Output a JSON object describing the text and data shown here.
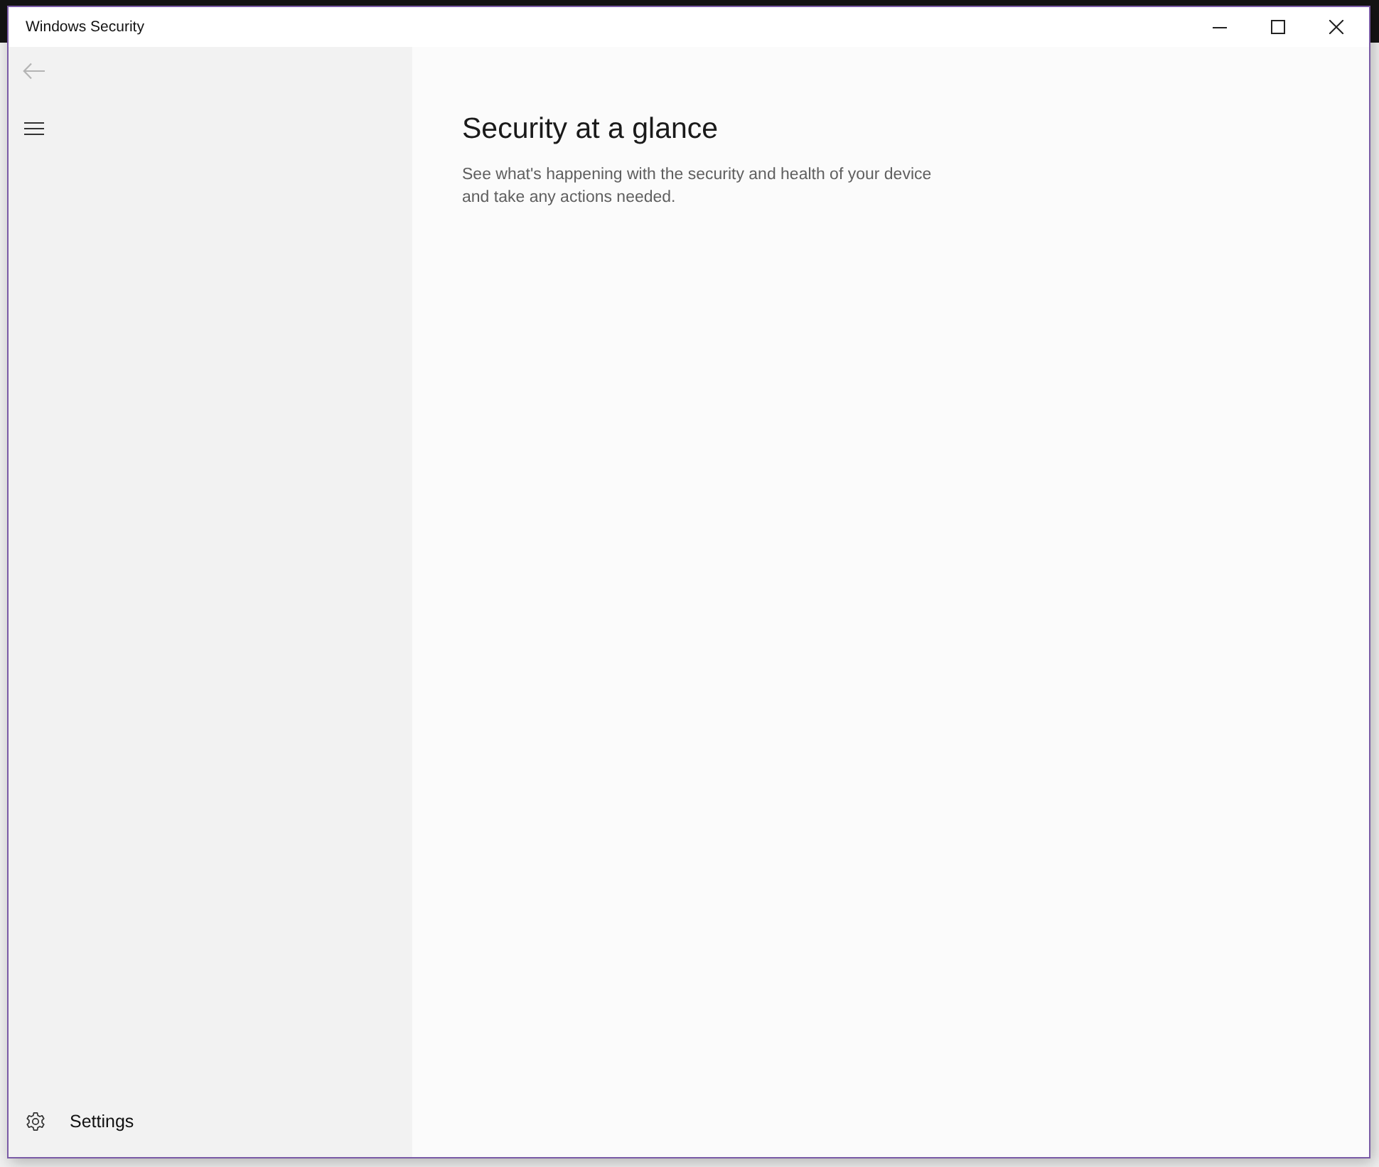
{
  "window": {
    "title": "Windows Security",
    "controls": [
      {
        "kind": "minimize"
      },
      {
        "kind": "maximize"
      },
      {
        "kind": "close"
      }
    ]
  },
  "sidebar": {
    "back_button": {
      "disabled": true
    },
    "footer_items": [
      {
        "kind": "settings",
        "label": "Settings"
      }
    ]
  },
  "main": {
    "heading": "Security at a glance",
    "description": "See what's happening with the security and health of your device and take any actions needed."
  }
}
